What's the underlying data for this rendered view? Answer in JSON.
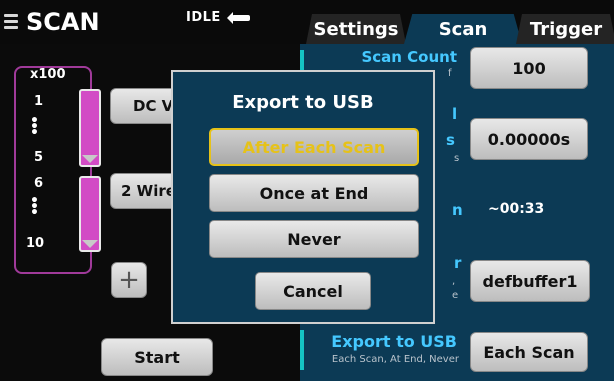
{
  "header": {
    "title": "SCAN",
    "status": "IDLE",
    "tabs": [
      "Settings",
      "Scan",
      "Trigger"
    ]
  },
  "channels": {
    "multiplier": "x100",
    "group1": {
      "start": "1",
      "end": "5",
      "label": "DC V"
    },
    "group2": {
      "start": "6",
      "end": "10",
      "label": "2 Wire"
    },
    "add_label": "+",
    "start_label": "Start"
  },
  "settings": {
    "scan_count_label": "Scan Count",
    "scan_count_sub": "f",
    "scan_count_value": "100",
    "interval_label": "l",
    "interval_label2": "s",
    "interval_sub": "s",
    "interval_value": "0.00000s",
    "duration_label": "n",
    "duration_value": "~00:33",
    "buffer_label": "r",
    "buffer_sub": ",",
    "buffer_sub2": "e",
    "buffer_value": "defbuffer1",
    "export_label": "Export to USB",
    "export_sub": "Each Scan, At End, Never",
    "export_value": "Each Scan"
  },
  "modal": {
    "title": "Export to USB",
    "options": [
      "After Each Scan",
      "Once at End",
      "Never"
    ],
    "selected_index": 0,
    "cancel": "Cancel"
  }
}
